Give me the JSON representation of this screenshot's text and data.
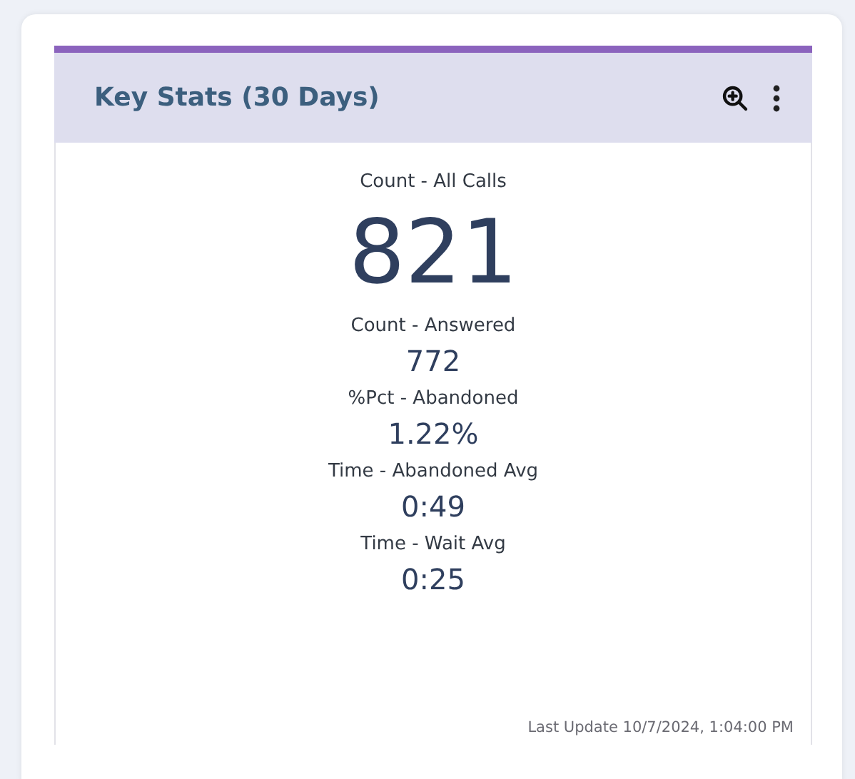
{
  "widget": {
    "title": "Key Stats (30 Days)",
    "footer": "Last Update 10/7/2024, 1:04:00 PM"
  },
  "stats": [
    {
      "kind": "primary",
      "label": "Count - All Calls",
      "value": "821"
    },
    {
      "kind": "secondary",
      "label": "Count - Answered",
      "value": "772"
    },
    {
      "kind": "secondary",
      "label": "%Pct - Abandoned",
      "value": "1.22%"
    },
    {
      "kind": "secondary",
      "label": "Time - Abandoned Avg",
      "value": "0:49"
    },
    {
      "kind": "secondary",
      "label": "Time - Wait Avg",
      "value": "0:25"
    }
  ]
}
